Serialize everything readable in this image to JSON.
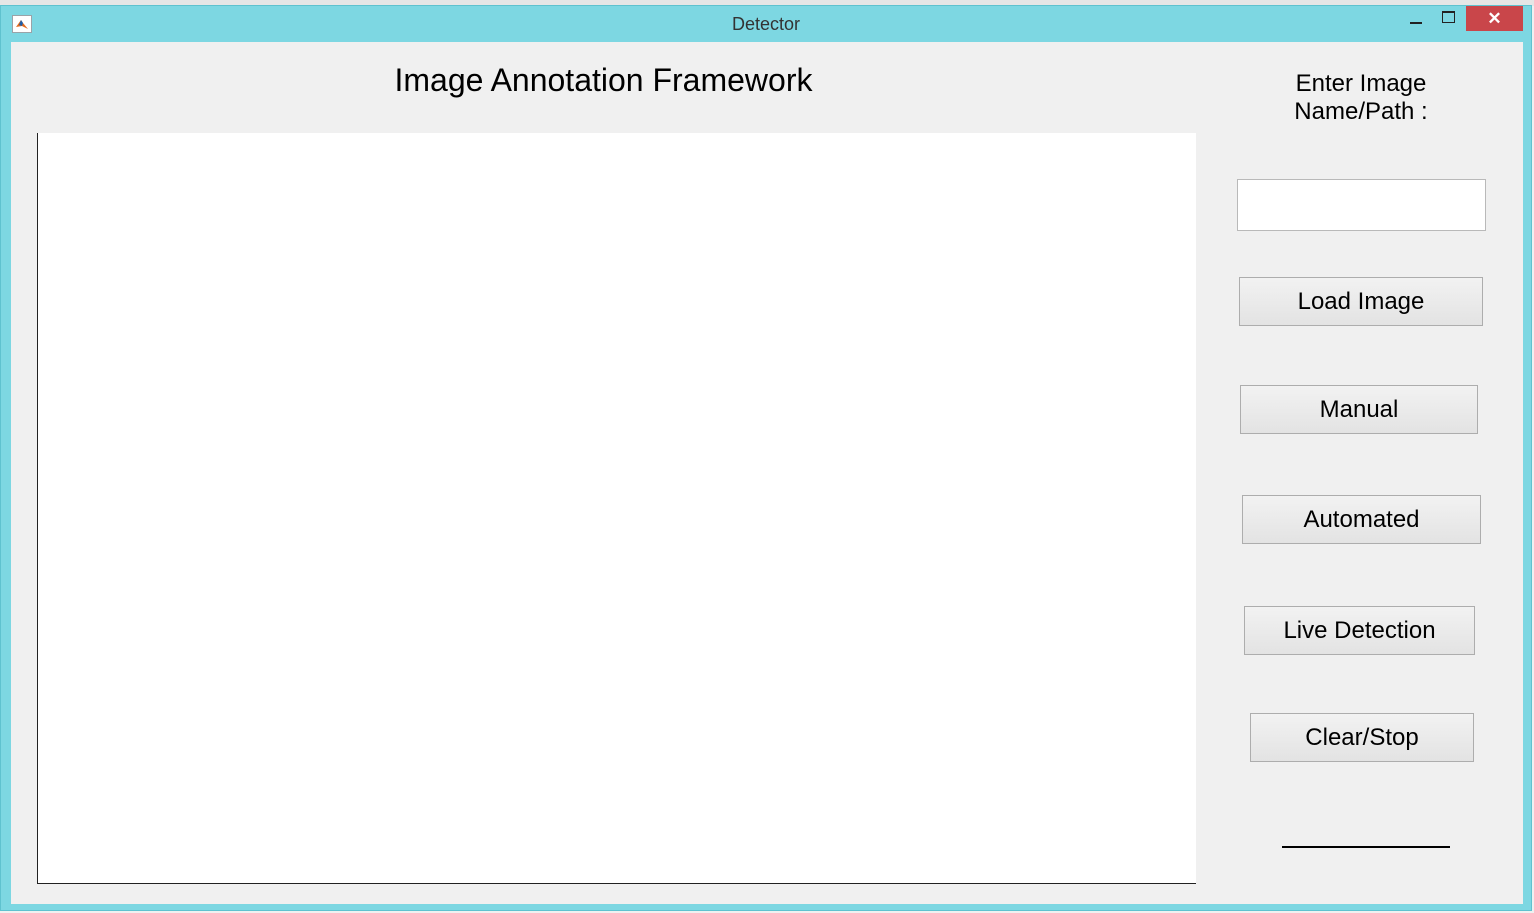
{
  "window": {
    "title": "Detector",
    "close_glyph": "✕",
    "icons": [
      "matlab-icon",
      "minimize-icon",
      "maximize-icon",
      "close-icon"
    ]
  },
  "main": {
    "heading": "Image Annotation Framework"
  },
  "sidebar": {
    "path_label": "Enter Image Name/Path :",
    "path_input_value": "",
    "buttons": {
      "load": "Load Image",
      "manual": "Manual",
      "automated": "Automated",
      "live": "Live Detection",
      "clear": "Clear/Stop"
    }
  },
  "colors": {
    "title_bar": "#7dd7e2",
    "close_button": "#c9464a",
    "background": "#f0f0f0"
  }
}
